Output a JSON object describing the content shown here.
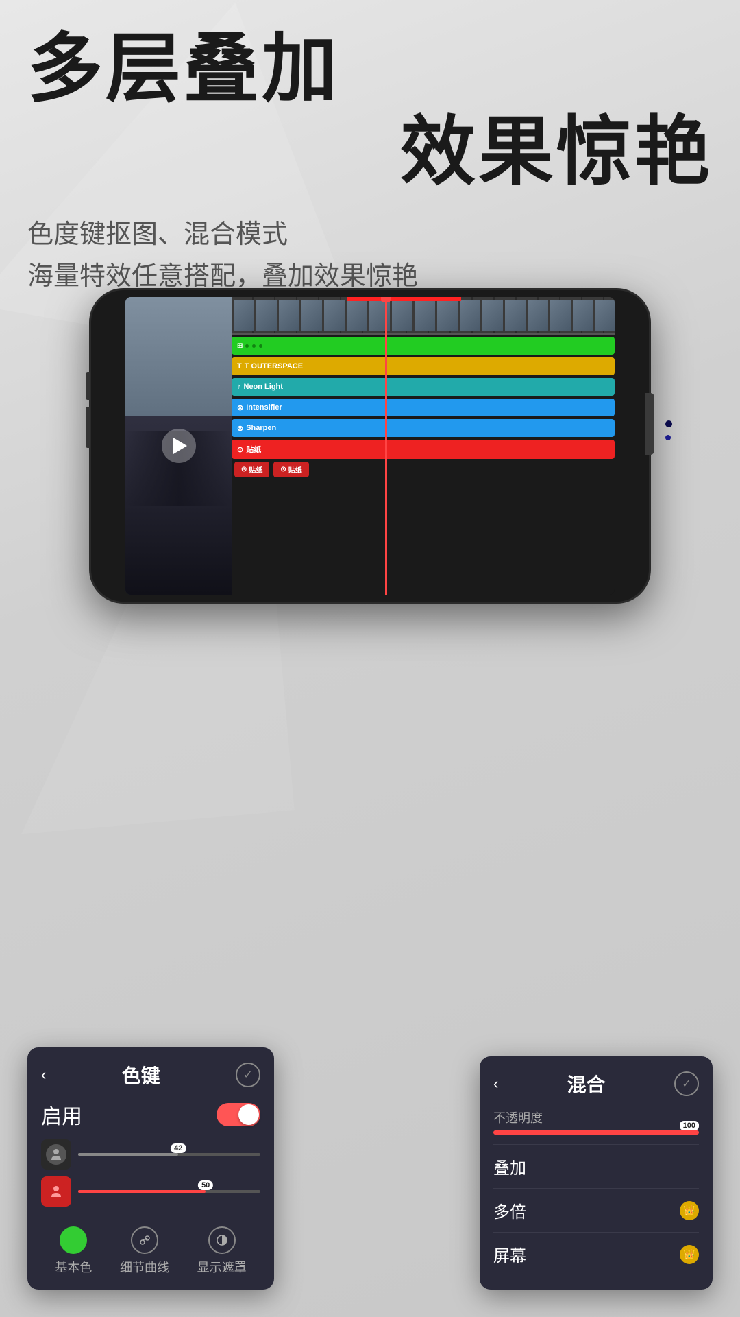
{
  "hero": {
    "title_line1": "多层叠加",
    "title_line2": "效果惊艳",
    "subtitle_line1": "色度键抠图、混合模式",
    "subtitle_line2": "海量特效任意搭配，叠加效果惊艳"
  },
  "timeline": {
    "tracks": [
      {
        "id": "video",
        "color": "film",
        "label": ""
      },
      {
        "id": "green1",
        "color": "#22cc22",
        "label": ""
      },
      {
        "id": "outerspace",
        "color": "#ddaa00",
        "label": "T  OUTERSPACE"
      },
      {
        "id": "neonlight",
        "color": "#22aaaa",
        "label": "Neon Light",
        "icon": "♪"
      },
      {
        "id": "intensifier",
        "color": "#2299ee",
        "label": "Intensifier",
        "icon": "⊗"
      },
      {
        "id": "sharpen",
        "color": "#2299ee",
        "label": "Sharpen",
        "icon": "⊗"
      },
      {
        "id": "sticker_red",
        "color": "#ee2222",
        "label": "贴纸",
        "icon": "⊙"
      }
    ],
    "sticker_tags": [
      "贴纸",
      "贴纸"
    ]
  },
  "panel_colorkey": {
    "back_icon": "‹",
    "title": "色键",
    "check_icon": "✓",
    "enable_label": "启用",
    "slider1": {
      "value": 42,
      "fill_pct": 55
    },
    "slider2": {
      "value": 50,
      "fill_pct": 70
    },
    "bottom_icons": [
      {
        "icon": "●",
        "label": "基本色",
        "type": "green"
      },
      {
        "icon": "⌒",
        "label": "细节曲线",
        "type": "curve"
      },
      {
        "icon": "◑",
        "label": "显示遮罩",
        "type": "contrast"
      }
    ]
  },
  "panel_mix": {
    "back_icon": "‹",
    "title": "混合",
    "check_icon": "✓",
    "opacity_label": "不透明度",
    "opacity_value": "100",
    "options": [
      {
        "label": "叠加",
        "has_crown": false
      },
      {
        "label": "多倍",
        "has_crown": true
      },
      {
        "label": "屏幕",
        "has_crown": true
      }
    ]
  },
  "colors": {
    "accent_red": "#ff4444",
    "track_green": "#22cc22",
    "track_yellow": "#ddaa00",
    "track_teal": "#22aaaa",
    "track_blue": "#2299ee",
    "track_red": "#ee2222"
  }
}
